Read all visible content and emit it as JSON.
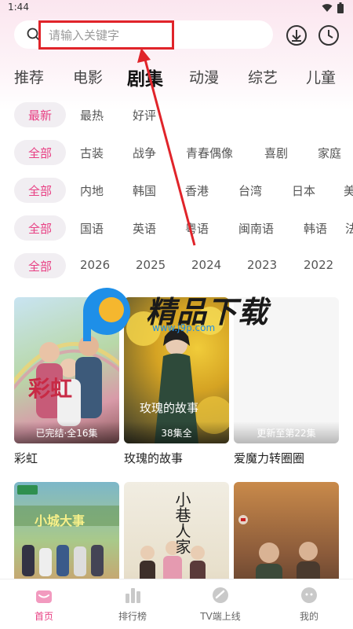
{
  "status": {
    "time": "1:44"
  },
  "search": {
    "placeholder": "请输入关键字"
  },
  "categories": [
    "推荐",
    "电影",
    "剧集",
    "动漫",
    "综艺",
    "儿童"
  ],
  "filters": {
    "sort": [
      "最新",
      "最热",
      "好评"
    ],
    "genre": [
      "全部",
      "古装",
      "战争",
      "青春偶像",
      "喜剧",
      "家庭"
    ],
    "region": [
      "全部",
      "内地",
      "韩国",
      "香港",
      "台湾",
      "日本",
      "美"
    ],
    "language": [
      "全部",
      "国语",
      "英语",
      "粤语",
      "闽南语",
      "韩语",
      "法"
    ],
    "year": [
      "全部",
      "2026",
      "2025",
      "2024",
      "2023",
      "2022"
    ]
  },
  "shows": [
    {
      "title": "彩虹",
      "badge": "已完结·全16集",
      "poster_text": "彩虹"
    },
    {
      "title": "玫瑰的故事",
      "badge": "38集全",
      "poster_text": "玫瑰的故事"
    },
    {
      "title": "爱魔力转圈圈",
      "badge": "更新至第22集",
      "poster_text": ""
    },
    {
      "title": "",
      "badge": "",
      "poster_text": "小城大事"
    },
    {
      "title": "",
      "badge": "",
      "poster_text": "小巷人家"
    },
    {
      "title": "",
      "badge": "",
      "poster_text": ""
    }
  ],
  "watermark": {
    "text": "精品下载",
    "url": "www.j9p.com"
  },
  "nav": [
    "首页",
    "排行榜",
    "TV端上线",
    "我的"
  ],
  "colors": {
    "accent": "#e83f83",
    "highlight": "#e0242a"
  }
}
